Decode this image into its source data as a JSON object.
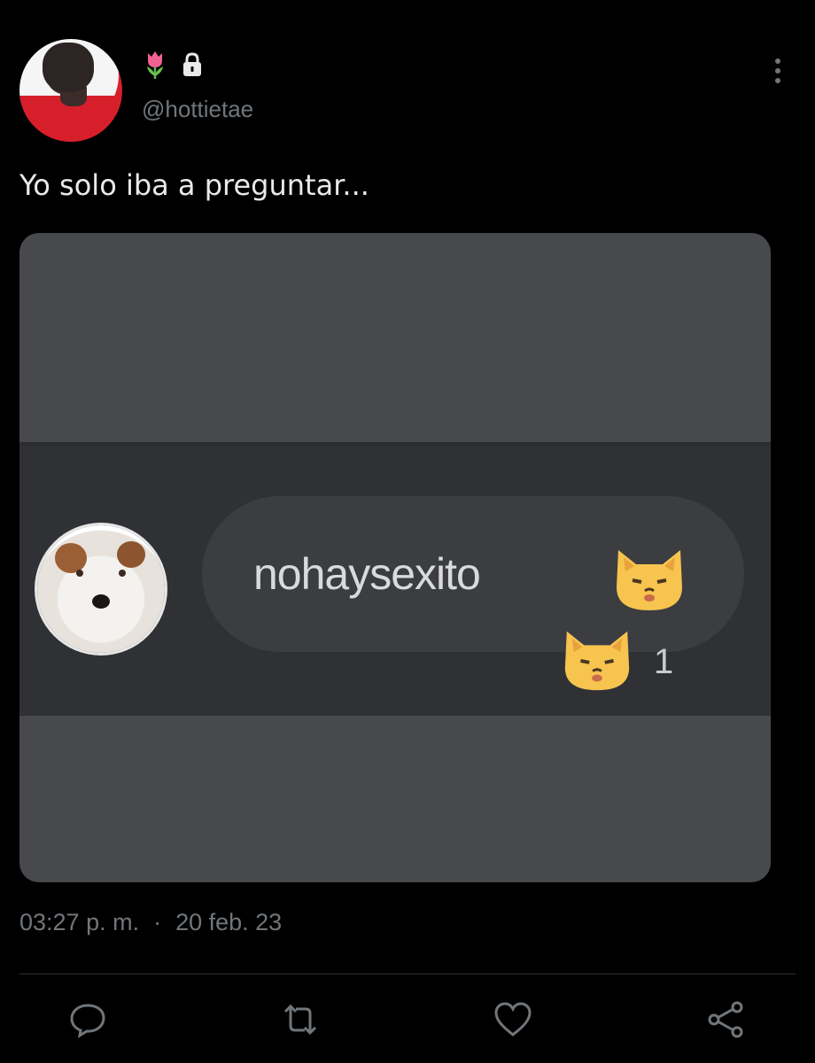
{
  "author": {
    "handle": "@hottietae",
    "badges": [
      "tulip-icon",
      "lock-icon"
    ]
  },
  "tweet": {
    "text": "Yo solo iba a preguntar...",
    "time": "03:27 p. m.",
    "separator": "·",
    "date": "20 feb. 23"
  },
  "media": {
    "message_text": "nohaysexito",
    "reaction_count": "1",
    "colors": {
      "background": "#48494d",
      "strip": "#2f3134",
      "bubble": "#3c3d41"
    }
  },
  "actions": [
    "reply-icon",
    "retweet-icon",
    "like-icon",
    "share-icon"
  ],
  "colors": {
    "page_bg": "#000000",
    "text": "#e7e9ea",
    "muted": "#71767b",
    "divider": "#2f3336"
  }
}
